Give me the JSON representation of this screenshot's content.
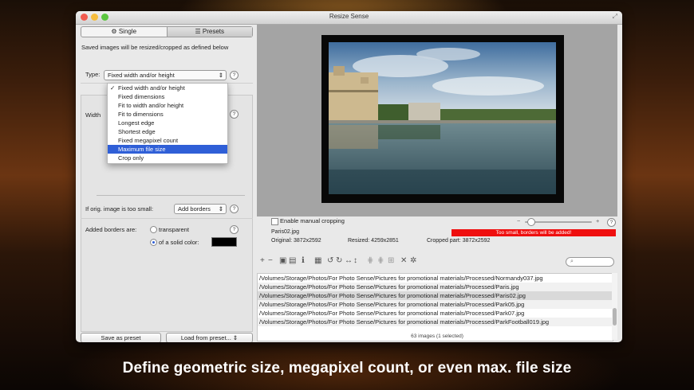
{
  "window": {
    "title": "Resize Sense"
  },
  "tabs": [
    {
      "label": "Single",
      "icon": "gear-icon"
    },
    {
      "label": "Presets",
      "icon": "list-icon"
    }
  ],
  "info": "Saved images will be resized/cropped as defined below",
  "type": {
    "label": "Type:",
    "selected": "Fixed width and/or height",
    "help": "?"
  },
  "type_menu": [
    {
      "label": "Fixed width and/or height",
      "checked": true
    },
    {
      "label": "Fixed dimensions"
    },
    {
      "label": "Fit to width and/or height"
    },
    {
      "label": "Fit to dimensions"
    },
    {
      "label": "Longest edge"
    },
    {
      "label": "Shortest edge"
    },
    {
      "label": "Fixed megapixel count"
    },
    {
      "label": "Maximum file size",
      "highlighted": true
    },
    {
      "label": "Crop only"
    }
  ],
  "width_label": "Width",
  "too_small": {
    "label": "If orig. image is too small:",
    "value": "Add borders",
    "help": "?"
  },
  "borders": {
    "label": "Added borders are:",
    "transparent": "transparent",
    "solid": "of a solid color:",
    "color": "#000000",
    "help": "?"
  },
  "buttons": {
    "save_preset": "Save as preset",
    "load_preset": "Load from preset..."
  },
  "preview": {
    "manual_crop": "Enable manual cropping",
    "zoom_minus": "−",
    "zoom_plus": "+",
    "help": "?",
    "filename": "Paris02.jpg",
    "warning": "Too small, borders will be added!",
    "original": "Original: 3872x2592",
    "resized": "Resized: 4259x2851",
    "cropped": "Cropped part: 3872x2592"
  },
  "files": [
    "/Volumes/Storage/Photos/For Photo Sense/Pictures for promotional materials/Processed/Normandy037.jpg",
    "/Volumes/Storage/Photos/For Photo Sense/Pictures for promotional materials/Processed/Paris.jpg",
    "/Volumes/Storage/Photos/For Photo Sense/Pictures for promotional materials/Processed/Paris02.jpg",
    "/Volumes/Storage/Photos/For Photo Sense/Pictures for promotional materials/Processed/Park05.jpg",
    "/Volumes/Storage/Photos/For Photo Sense/Pictures for promotional materials/Processed/Park07.jpg",
    "/Volumes/Storage/Photos/For Photo Sense/Pictures for promotional materials/Processed/ParkFootball019.jpg"
  ],
  "selected_index": 2,
  "status": "63 images (1 selected)",
  "caption": "Define geometric size, megapixel count, or even max. file size",
  "colors": {
    "highlight": "#2f5fd7",
    "warning": "#ef0f0f",
    "close": "#f25b50",
    "minimize": "#f6bd3e",
    "zoom": "#5bc63f"
  }
}
